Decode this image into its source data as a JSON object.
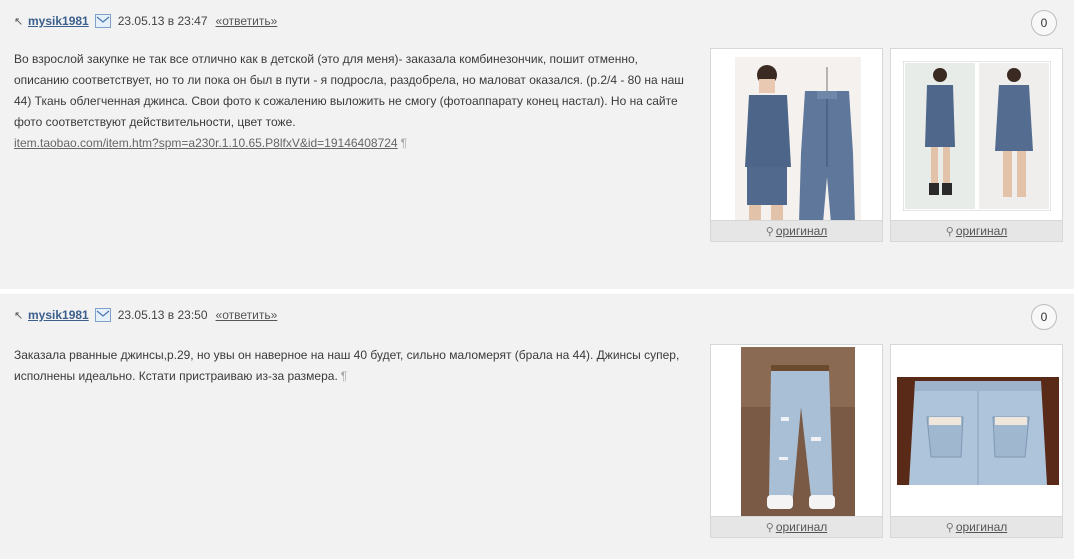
{
  "comments": [
    {
      "author": "mysik1981",
      "date": "23.05.13 в 23:47",
      "reply_label": "«ответить»",
      "votes": "0",
      "text_lines": [
        "Во взрослой закупке не так все отлично как в детской (это для меня)- заказала комбинезончик, пошит отменно,",
        "описанию соответствует, но то ли пока он был в пути - я подросла, раздобрела, но маловат оказался. (р.2/4 - 80 на наш",
        "44) Ткань облегченная джинса. Свои фото к сожалению выложить не смогу (фотоаппарату конец настал). Но на сайте",
        "фото соответствуют действительности, цвет тоже."
      ],
      "link": "item.taobao.com/item.htm?spm=a230r.1.10.65.P8lfxV&id=19146408724",
      "pilcrow": "¶",
      "images": [
        {
          "label": "оригинал",
          "icon": "magnifier-icon"
        },
        {
          "label": "оригинал",
          "icon": "magnifier-icon"
        }
      ]
    },
    {
      "author": "mysik1981",
      "date": "23.05.13 в 23:50",
      "reply_label": "«ответить»",
      "votes": "0",
      "text_lines": [
        "Заказала рванные джинсы,р.29, но увы он наверное на наш 40 будет, сильно маломерят (брала на 44). Джинсы супер,",
        "исполнены идеально. Кстати пристраиваю из-за размера."
      ],
      "pilcrow": "¶",
      "images": [
        {
          "label": "оригинал",
          "icon": "magnifier-icon"
        },
        {
          "label": "оригинал",
          "icon": "magnifier-icon"
        }
      ]
    }
  ],
  "colors": {
    "background": "#f2f2f2",
    "author": "#3b5f8c",
    "denim": "#5b6f8f",
    "light_denim": "#a9bfd6"
  }
}
